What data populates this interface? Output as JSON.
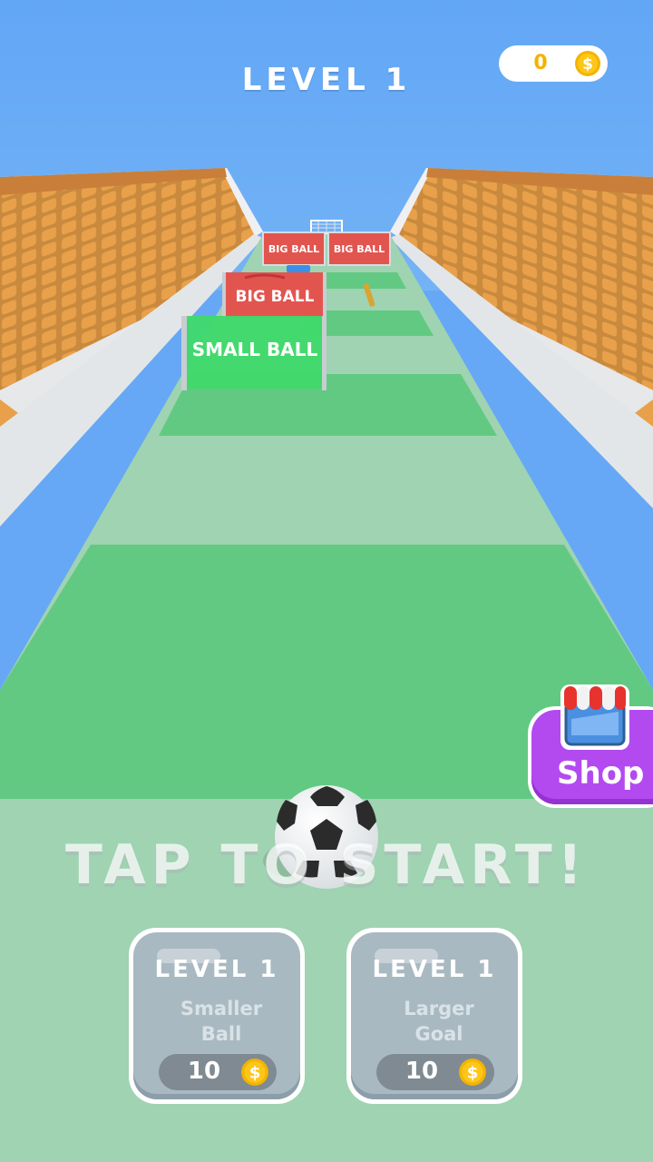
{
  "hud": {
    "level_title": "LEVEL 1",
    "coins": "0",
    "settings_icon": "gear-icon",
    "coin_icon": "dollar-coin-icon"
  },
  "track": {
    "gates": [
      {
        "label": "BIG BALL",
        "color": "#e2554f"
      },
      {
        "label": "BIG BALL",
        "color": "#e2554f"
      },
      {
        "label": "BIG BALL",
        "color": "#e2554f"
      },
      {
        "label": "SMALL BALL",
        "color": "#3fd96a"
      }
    ]
  },
  "prompt": {
    "text": "TAP TO START!"
  },
  "shop": {
    "label": "Shop",
    "icon": "storefront-icon",
    "color": "#b34af0"
  },
  "upgrades": [
    {
      "level": "LEVEL 1",
      "name_line1": "Smaller",
      "name_line2": "Ball",
      "price": "10"
    },
    {
      "level": "LEVEL 1",
      "name_line1": "Larger",
      "name_line2": "Goal",
      "price": "10"
    }
  ],
  "colors": {
    "sky": "#66a8f5",
    "grass": "#62c982",
    "track": "#9fd3b1",
    "seats": "#e8a14a"
  }
}
